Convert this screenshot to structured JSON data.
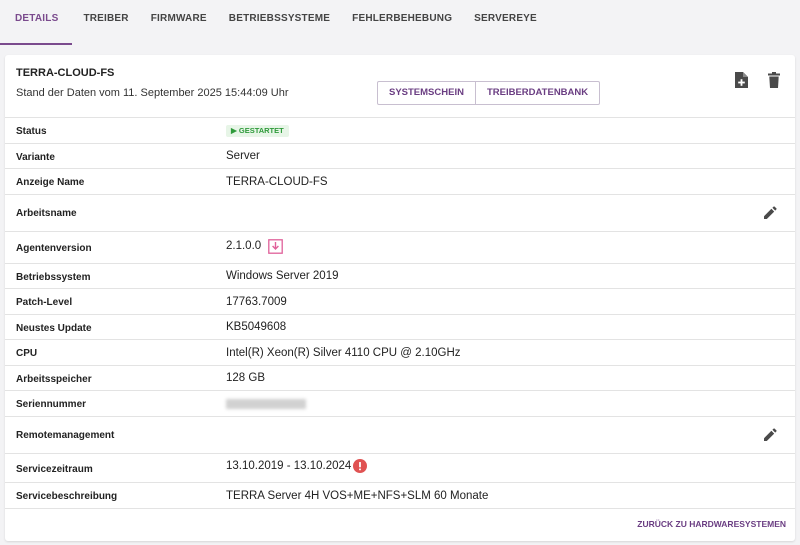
{
  "tabs": [
    "Details",
    "Treiber",
    "Firmware",
    "Betriebssysteme",
    "Fehlerbehebung",
    "Servereye"
  ],
  "header": {
    "title": "TERRA-CLOUD-FS",
    "subtitle": "Stand der Daten vom 11. September 2025 15:44:09 Uhr",
    "buttons": [
      "Systemschein",
      "Treiberdatenbank"
    ],
    "icons": [
      "add-document-icon",
      "delete-icon"
    ]
  },
  "rows": {
    "status": {
      "label": "Status",
      "badge": "Gestartet"
    },
    "variante": {
      "label": "Variante",
      "value": "Server"
    },
    "anzeige_name": {
      "label": "Anzeige Name",
      "value": "TERRA-CLOUD-FS"
    },
    "arbeitsname": {
      "label": "Arbeitsname",
      "value": ""
    },
    "agentenversion": {
      "label": "Agentenversion",
      "value": "2.1.0.0"
    },
    "betriebssystem": {
      "label": "Betriebssystem",
      "value": "Windows Server 2019"
    },
    "patch_level": {
      "label": "Patch-Level",
      "value": "17763.7009"
    },
    "neustes_update": {
      "label": "Neustes Update",
      "value": "KB5049608"
    },
    "cpu": {
      "label": "CPU",
      "value": "Intel(R) Xeon(R) Silver 4110 CPU @ 2.10GHz"
    },
    "arbeitsspeicher": {
      "label": "Arbeitsspeicher",
      "value": "128 GB"
    },
    "seriennummer": {
      "label": "Seriennummer"
    },
    "remotemanagement": {
      "label": "Remotemanagement",
      "value": ""
    },
    "servicezeitraum": {
      "label": "Servicezeitraum",
      "value": "13.10.2019 - 13.10.2024"
    },
    "servicebeschreibung": {
      "label": "Servicebeschreibung",
      "value": "TERRA Server 4H VOS+ME+NFS+SLM 60 Monate"
    }
  },
  "footer": {
    "back_link": "Zurück zu Hardwaresystemen"
  },
  "colors": {
    "accent": "#6a3d82",
    "status_green": "#2e9a3a",
    "alert_red": "#e05252",
    "download_pink": "#e0609a"
  }
}
